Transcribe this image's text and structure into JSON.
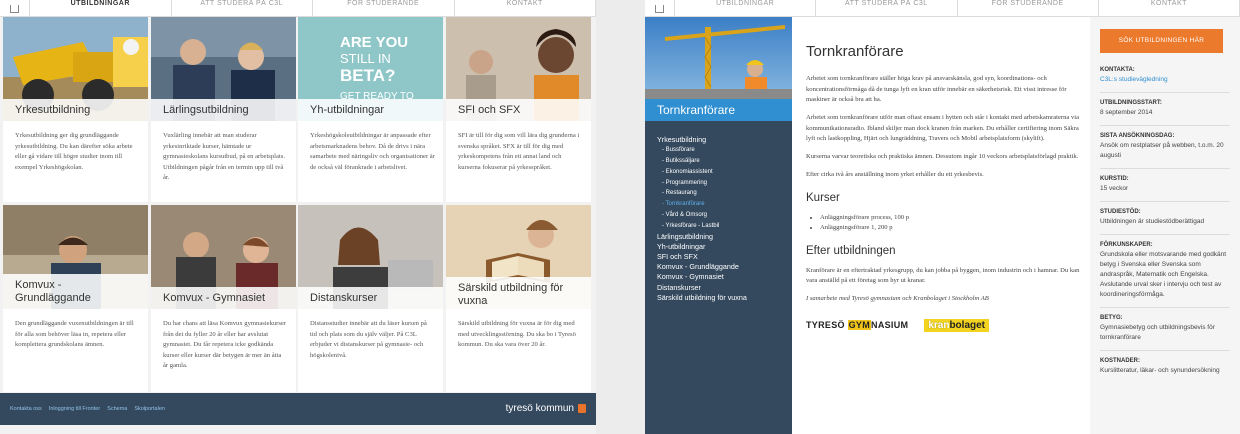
{
  "left": {
    "nav": [
      "UTBILDNINGAR",
      "ATT STUDERA PÅ C3L",
      "FÖR STUDERANDE",
      "KONTAKT"
    ],
    "cards": [
      {
        "title": "Yrkesutbildning",
        "desc": "Yrkesutbildning ger dig grundläggande yrkesutbildning. Du kan därefter söka arbete eller gå vidare till högre studier inom till exempel Yrkeshögskolan."
      },
      {
        "title": "Lärlingsutbildning",
        "desc": "Vuxlärling innebär att man studerar yrkesinriktade kurser, hämtade ur gymnasieskolans kursutbud, på en arbetsplats. Utbildningen pågår från en termin upp till två år."
      },
      {
        "title": "Yh-utbildningar",
        "desc": "Yrkeshögskoleutbildningar är anpassade efter arbetsmarknadens behov. Då de drivs i nära samarbete med näringsliv och organisationer är de också väl förankrade i arbetslivet."
      },
      {
        "title": "SFI och SFX",
        "desc": "SFI är till för dig som vill lära dig grunderna i svenska språket. SFX är till för dig med yrkeskompetens från ett annat land och kurserna fokuserar på yrkesspråket."
      },
      {
        "title": "Komvux - Grundläggande",
        "desc": "Den grundläggande vuxenutbildningen är till för alla som behöver läsa in, repetera eller komplettera grundskolans ämnen."
      },
      {
        "title": "Komvux - Gymnasiet",
        "desc": "Du har chans att läsa Komvux gymnasiekurser från det du fyller 20 år eller har avslutat gymnasiet. Du får repetera icke godkända kurser eller kurser där betygen är mer än åtta år gamla."
      },
      {
        "title": "Distanskurser",
        "desc": "Distansstudier innebär att du läser kursen på tid och plats som du själv väljer. På C3L erbjuder vi distanskurser på gymnasie- och högskolenivå."
      },
      {
        "title": "Särskild utbildning för vuxna",
        "desc": "Särskild utbildning för vuxna är för dig med med utvecklingsstörning. Du ska bo i Tyresö kommun. Du ska vara över 20 år."
      }
    ],
    "beta_text": [
      "ARE YOU",
      "STILL IN",
      "BETA?",
      "GET READY TO"
    ],
    "footer_links": [
      "Kontakta oss",
      "Inloggning till Fronter",
      "Schema",
      "Skolportalen"
    ],
    "footer_brand": "tyresö kommun"
  },
  "right": {
    "nav": [
      "UTBILDNINGAR",
      "ATT STUDERA PÅ C3L",
      "FÖR STUDERANDE",
      "KONTAKT"
    ],
    "hero_title": "Tornkranförare",
    "sidebar_nav": [
      {
        "label": "Yrkesutbildning",
        "level": 0
      },
      {
        "label": "- Bussförare",
        "level": 1
      },
      {
        "label": "- Butikssäljare",
        "level": 1
      },
      {
        "label": "- Ekonomiassistent",
        "level": 1
      },
      {
        "label": "- Programmering",
        "level": 1
      },
      {
        "label": "- Restaurang",
        "level": 1
      },
      {
        "label": "- Tornkranförare",
        "level": 1,
        "active": true
      },
      {
        "label": "- Vård & Omsorg",
        "level": 1
      },
      {
        "label": "- Yrkesförare - Lastbil",
        "level": 1
      },
      {
        "label": "Lärlingsutbildning",
        "level": 0
      },
      {
        "label": "Yh-utbildningar",
        "level": 0
      },
      {
        "label": "SFI och SFX",
        "level": 0
      },
      {
        "label": "Komvux - Grundläggande",
        "level": 0
      },
      {
        "label": "Komvux - Gymnasiet",
        "level": 0
      },
      {
        "label": "Distanskurser",
        "level": 0
      },
      {
        "label": "Särskild utbildning för vuxna",
        "level": 0
      }
    ],
    "content": {
      "title": "Tornkranförare",
      "p1": "Arbetet som tornkranförare ställer höga krav på ansvarskänsla, god syn, koordinations- och koncentrationsförmåga då de tunga lyft en kran utför innebär en säkerhetsrisk. Ett visst intresse för maskiner är också bra att ha.",
      "p2": "Arbetet som tornkranförare utför man oftast ensam i hytten och står i kontakt med arbetskamraterna via kommunikationsradio. Ibland skiljer man dock kranen från marken. Du erhåller certifiering inom Säkra lyft och lastkoppling, Hjärt och lungräddning, Travers och Mobil arbetsplatsform (skylift).",
      "p3": "Kurserna varvar teoretiska och praktiska ämnen. Dessutom ingår 10 veckors arbetsplatsförlagd praktik.",
      "p4": "Efter cirka två års anställning inom yrket erhåller du ett yrkesbevis.",
      "h_kurser": "Kurser",
      "kurser": [
        "Anläggningsförare process, 100 p",
        "Anläggningsförare 1, 200 p"
      ],
      "h_efter": "Efter utbildningen",
      "p5": "Kranförare är en eftertraktad yrkesgrupp, du kan jobba på byggen, inom industrin och i hamnar. Du kan vara anställd på ett företag som hyr ut kranar.",
      "p6": "I samarbete med Tyresö gymnasium och Kranbolaget i Stockholm AB",
      "logo1_pre": "TYRESÖ ",
      "logo1_hl": "GYM",
      "logo1_post": "NASIUM",
      "logo2_a": "kran",
      "logo2_b": "bolaget"
    },
    "info": {
      "button": "SÖK UTBILDNINGEN HÄR",
      "sections": [
        {
          "label": "KONTAKTA:",
          "value": "C3L:s studievägledning",
          "link": true
        },
        {
          "label": "UTBILDNINGSSTART:",
          "value": "8 september 2014"
        },
        {
          "label": "SISTA ANSÖKNINGSDAG:",
          "value": "Ansök om restplatser på webben, t.o.m. 20 augusti"
        },
        {
          "label": "KURSTID:",
          "value": "15 veckor"
        },
        {
          "label": "STUDIESTÖD:",
          "value": "Utbildningen är studiestödberättigad"
        },
        {
          "label": "FÖRKUNSKAPER:",
          "value": "Grundskola eller motsvarande med godkänt betyg i Svenska eller Svenska som andraspråk, Matematik och Engelska. Avslutande urval sker i intervju och test av koordineringsförmåga."
        },
        {
          "label": "BETYG:",
          "value": "Gymnasiebetyg och utbildningsbevis för tornkranförare"
        },
        {
          "label": "KOSTNADER:",
          "value": "Kurslitteratur, läkar- och synundersökning"
        }
      ]
    }
  }
}
